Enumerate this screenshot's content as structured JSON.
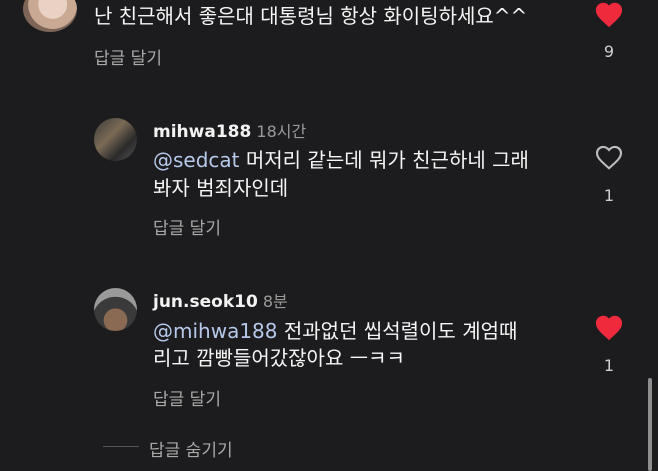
{
  "comments": [
    {
      "text": "난 친근해서 좋은대  대통령님 항상 화이팅하세요^^",
      "reply_label": "답글 달기",
      "likes": "9",
      "liked": true
    },
    {
      "username": "mihwa188",
      "time": "18시간",
      "mention": "@sedcat",
      "text_line1": " 머저리 같는데  뭐가 친근하네 그래",
      "text_line2": "봐자 범죄자인데",
      "reply_label": "답글 달기",
      "likes": "1",
      "liked": false
    },
    {
      "username": "jun.seok10",
      "time": "8분",
      "mention": "@mihwa188",
      "text_line1": "  전과없던 씹석렬이도 계엄때",
      "text_line2": "리고 깜빵들어갔잖아요 ㅡㅋㅋ",
      "reply_label": "답글 달기",
      "likes": "1",
      "liked": true
    }
  ],
  "hide_replies_label": "답글 숨기기",
  "colors": {
    "background": "#1c1c1e",
    "heart_liked": "#ee2a3c",
    "mention": "#b7c9ea"
  }
}
